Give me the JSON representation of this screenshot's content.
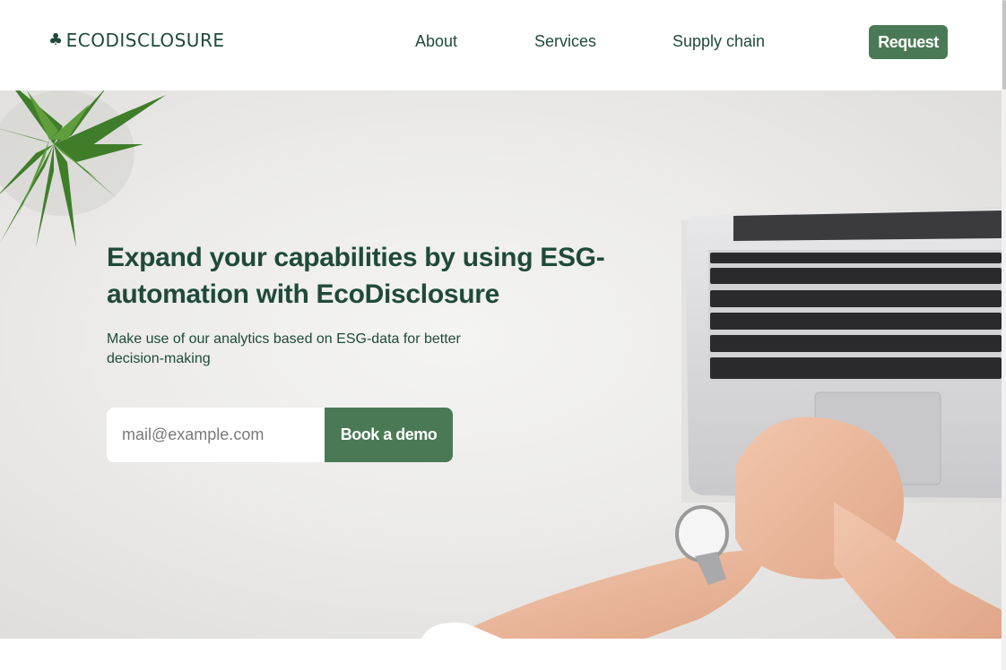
{
  "brand": {
    "name": "ECODISCLOSURE",
    "icon": "clover-icon",
    "color": "#1f4a3b"
  },
  "nav": {
    "about": "About",
    "services": "Services",
    "supply_chain": "Supply chain",
    "request": "Request"
  },
  "hero": {
    "title": "Expand your capabilities by using ESG-automation with EcoDisclosure",
    "subtitle": "Make use of our analytics based on ESG-data for better decision-making",
    "email_placeholder": "mail@example.com",
    "cta": "Book a demo",
    "background": "photo of a white desk with a potted plant, a laptop and clasped hands wearing a wristwatch"
  },
  "colors": {
    "accent": "#4a7a55",
    "text": "#1f4a3b",
    "background": "#ffffff"
  }
}
